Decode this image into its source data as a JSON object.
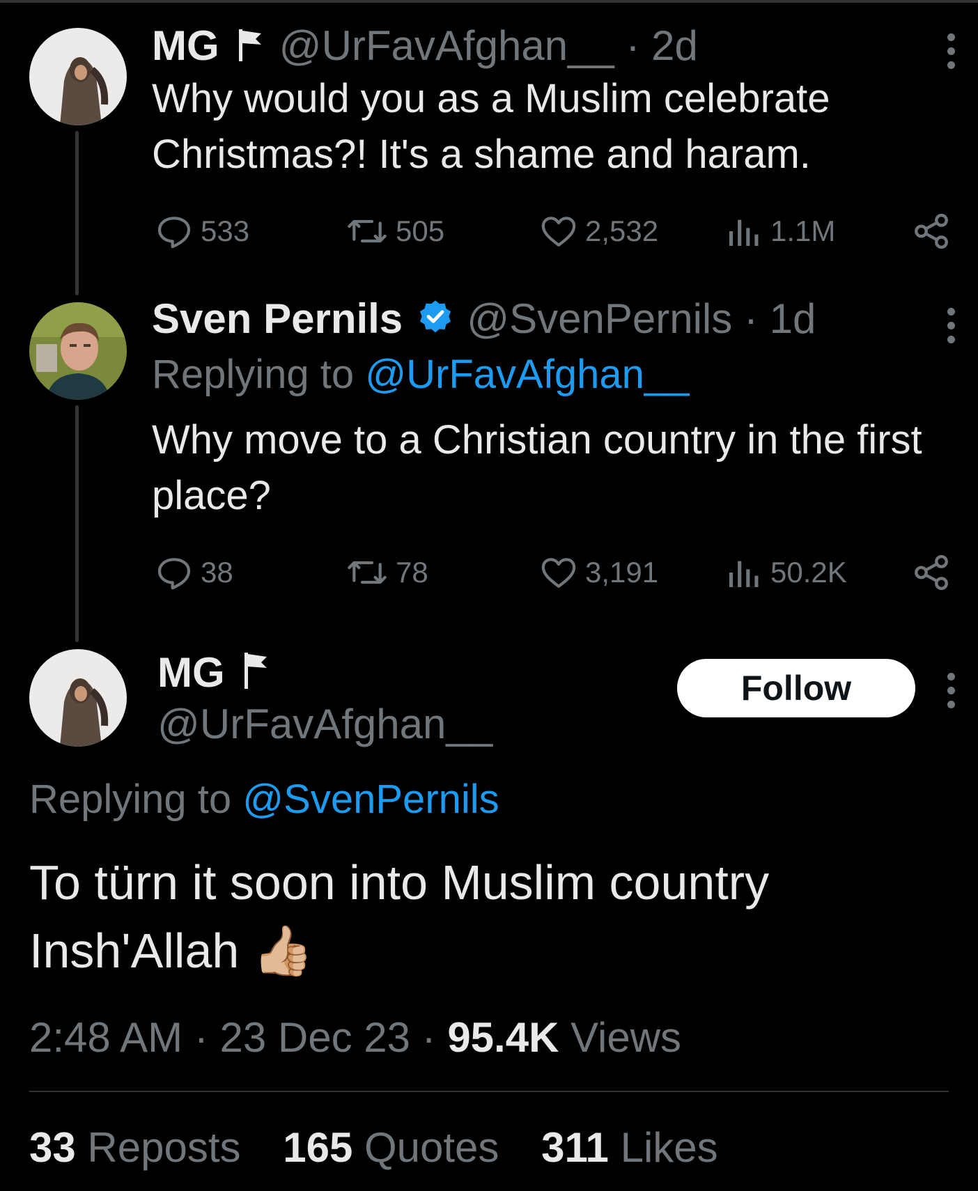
{
  "tweet1": {
    "name": "MG",
    "handle": "@UrFavAfghan__",
    "sep": "·",
    "time": "2d",
    "text": "Why would you as a Muslim celebrate Christmas?! It's a shame and haram.",
    "replies": "533",
    "reposts": "505",
    "likes": "2,532",
    "views": "1.1M"
  },
  "tweet2": {
    "name": "Sven Pernils",
    "handle": "@SvenPernils",
    "sep": "·",
    "time": "1d",
    "replying_prefix": "Replying to ",
    "replying_to": "@UrFavAfghan__",
    "text": "Why move to a Christian country in the first place?",
    "replies": "38",
    "reposts": "78",
    "likes": "3,191",
    "views": "50.2K"
  },
  "main_tweet": {
    "name": "MG",
    "handle": "@UrFavAfghan__",
    "follow_label": "Follow",
    "replying_prefix": "Replying to ",
    "replying_to": "@SvenPernils",
    "text": "To türn it soon into Muslim country Insh'Allah",
    "emoji": "👍🏼",
    "time": "2:48 AM",
    "sep": "·",
    "date": "23 Dec 23",
    "views_count": "95.4K",
    "views_label": " Views",
    "reposts_count": "33",
    "reposts_label": " Reposts",
    "quotes_count": "165",
    "quotes_label": " Quotes",
    "likes_count": "311",
    "likes_label": " Likes"
  },
  "colors": {
    "background": "#000000",
    "text": "#e7e9ea",
    "muted": "#71767b",
    "link": "#1d9bf0",
    "verified": "#1d9bf0"
  },
  "icons": [
    "flag-icon",
    "verified-badge-icon",
    "reply-icon",
    "repost-icon",
    "like-icon",
    "views-icon",
    "share-icon",
    "more-icon",
    "thumbs-up-emoji"
  ]
}
